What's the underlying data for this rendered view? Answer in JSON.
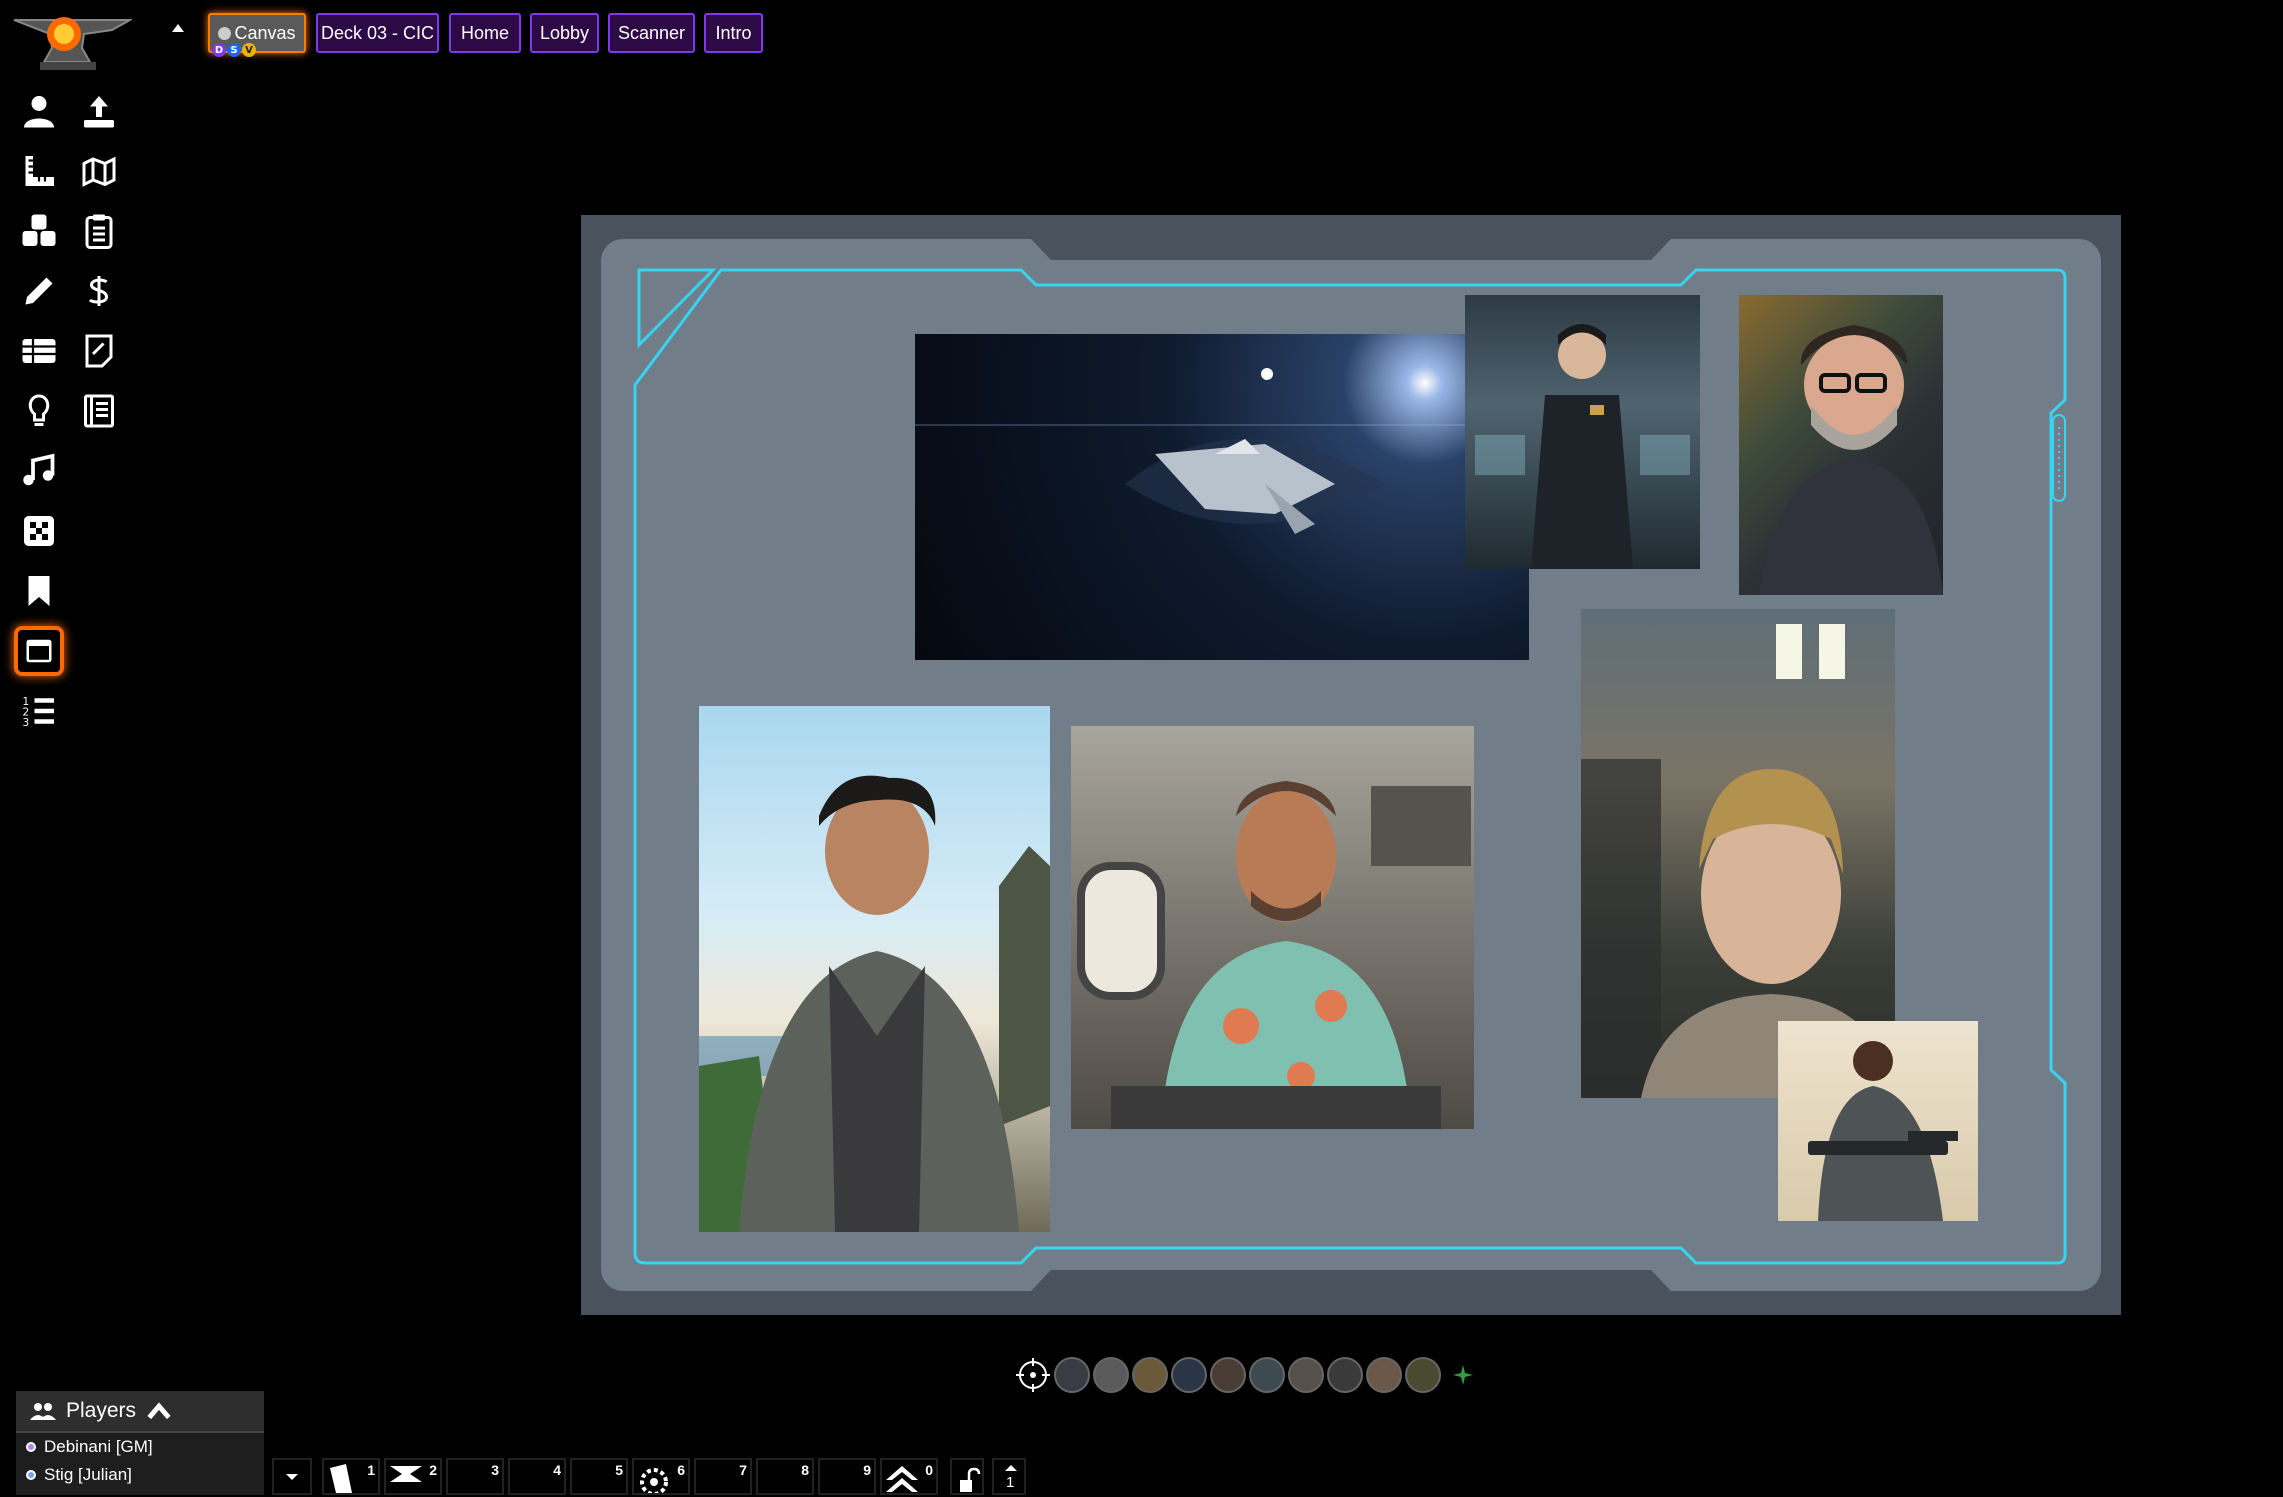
{
  "scene_tabs": [
    {
      "label": "Canvas",
      "active": true
    },
    {
      "label": "Deck 03 - CIC",
      "active": false
    },
    {
      "label": "Home",
      "active": false
    },
    {
      "label": "Lobby",
      "active": false
    },
    {
      "label": "Scanner",
      "active": false
    },
    {
      "label": "Intro",
      "active": false
    }
  ],
  "active_scene_badges": [
    {
      "letter": "D",
      "color": "#7c3aed"
    },
    {
      "letter": "S",
      "color": "#2563eb"
    },
    {
      "letter": "V",
      "color": "#eab308"
    }
  ],
  "toolbar": {
    "tools": [
      "person-icon",
      "upload-icon",
      "ruler-icon",
      "map-icon",
      "dice-icon",
      "clipboard-icon",
      "pencil-icon",
      "dollar-icon",
      "table-icon",
      "note-icon",
      "lightbulb-icon",
      "journal-icon",
      "music-icon",
      "checker-icon",
      "bookmark-icon",
      "window-icon",
      "list-icon"
    ],
    "active_tool": "window-icon"
  },
  "board": {
    "images": [
      "spaceship-image",
      "officer-portrait-image",
      "bearded-man-portrait-image",
      "woman-astronaut-portrait-image",
      "man-vest-portrait-image",
      "pilot-portrait-image",
      "armored-soldier-portrait-image"
    ]
  },
  "tokens": {
    "count": 10,
    "colors": [
      "#3b3b46",
      "#5a5a5a",
      "#6b5a3a",
      "#2a3548",
      "#4a3d36",
      "#3d4a50",
      "#55504a",
      "#3a3a3a",
      "#6b5848",
      "#4a4a30"
    ]
  },
  "players": {
    "title": "Players",
    "list": [
      {
        "name": "Debinani [GM]",
        "color": "#b084f5"
      },
      {
        "name": "Stig [Julian]",
        "color": "#7aa0f5"
      }
    ]
  },
  "hotbar": {
    "slots": [
      "1",
      "2",
      "3",
      "4",
      "5",
      "6",
      "7",
      "8",
      "9",
      "0"
    ],
    "page": "1"
  }
}
